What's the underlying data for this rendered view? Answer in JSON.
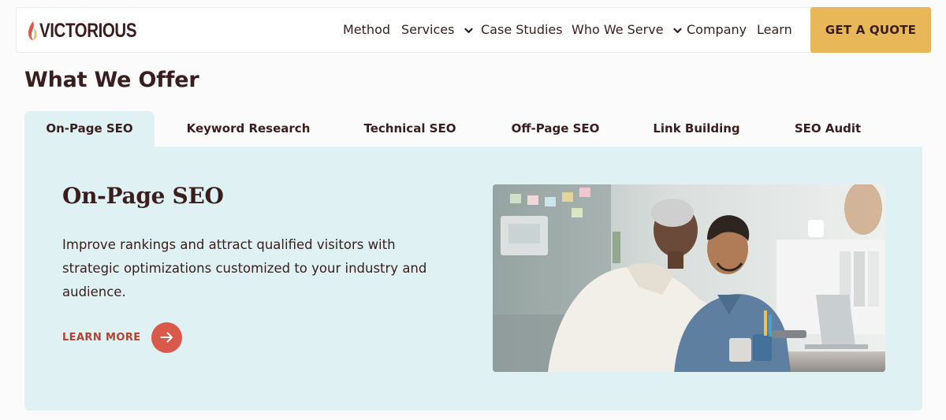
{
  "header": {
    "logo_text": "VICTORIOUS",
    "nav": [
      {
        "label": "Method",
        "dropdown": false
      },
      {
        "label": "Services",
        "dropdown": true
      },
      {
        "label": "Case Studies",
        "dropdown": false
      },
      {
        "label": "Who We Serve",
        "dropdown": true
      },
      {
        "label": "Company",
        "dropdown": false
      },
      {
        "label": "Learn",
        "dropdown": false
      }
    ],
    "cta_label": "GET A QUOTE"
  },
  "section": {
    "title": "What We Offer",
    "tabs": [
      {
        "label": "On-Page SEO",
        "active": true
      },
      {
        "label": "Keyword Research",
        "active": false
      },
      {
        "label": "Technical SEO",
        "active": false
      },
      {
        "label": "Off-Page SEO",
        "active": false
      },
      {
        "label": "Link Building",
        "active": false
      },
      {
        "label": "SEO Audit",
        "active": false
      }
    ]
  },
  "panel": {
    "title": "On-Page SEO",
    "description": "Improve rankings and attract qualified visitors with strategic optimizations customized to your industry and audience.",
    "learn_more_label": "LEARN MORE"
  },
  "colors": {
    "brand_text": "#3a1d1d",
    "accent_gold": "#e8b758",
    "panel_bg": "#dff1f2",
    "learn_more_red": "#b54130",
    "arrow_button": "#d9594a"
  },
  "icons": {
    "logo_mark": "flame-icon",
    "dropdown": "chevron-down-icon",
    "learn_more_arrow": "arrow-right-icon"
  }
}
